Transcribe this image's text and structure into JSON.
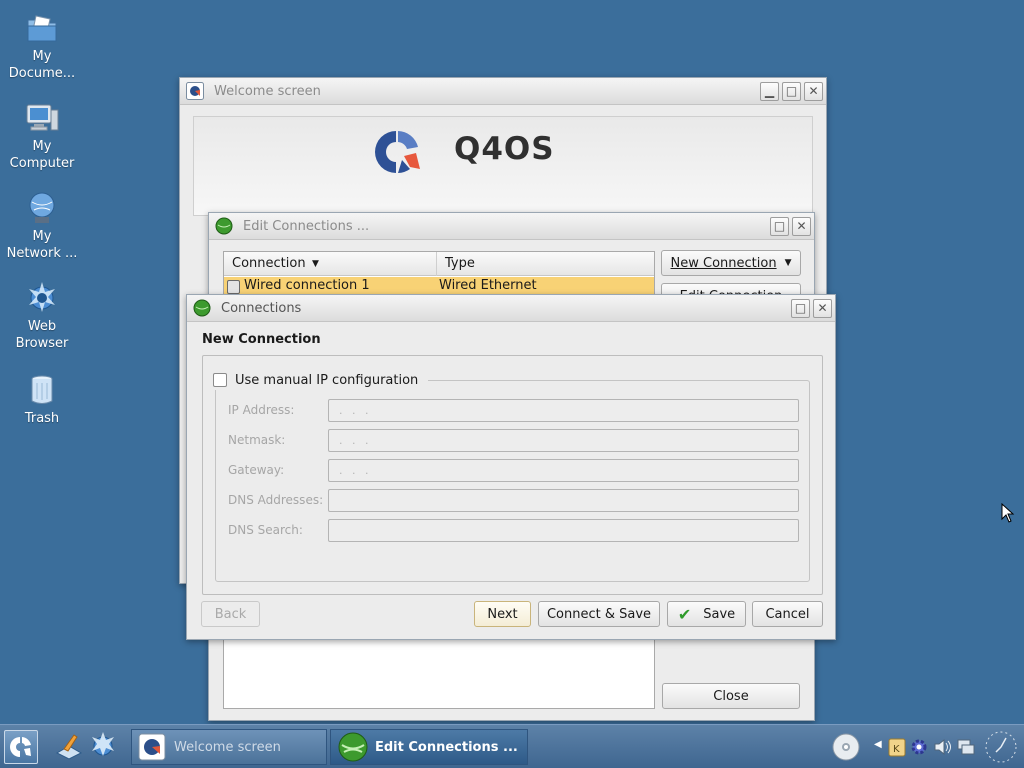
{
  "desktop": {
    "icons": [
      {
        "label": "My\nDocume...",
        "icon": "folder-documents-icon"
      },
      {
        "label": "My\nComputer",
        "icon": "computer-icon"
      },
      {
        "label": "My\nNetwork ...",
        "icon": "network-icon"
      },
      {
        "label": "Web\nBrowser",
        "icon": "web-browser-icon"
      },
      {
        "label": "Trash",
        "icon": "trash-icon"
      }
    ]
  },
  "welcome_window": {
    "title": "Welcome screen",
    "brand_text": "Q4OS"
  },
  "edit_connections_window": {
    "title": "Edit Connections ...",
    "columns": [
      "Connection",
      "Type"
    ],
    "rows": [
      {
        "connection": "Wired connection 1",
        "type": "Wired Ethernet",
        "selected": true
      }
    ],
    "new_connection_button": "New Connection",
    "edit_connection_button": "Edit Connection",
    "close_button": "Close"
  },
  "connections_dialog": {
    "title": "Connections",
    "heading": "New Connection",
    "manual_ip_checkbox": {
      "label": "Use manual IP configuration",
      "checked": false
    },
    "fields": [
      {
        "label": "IP Address:",
        "value": ". . ."
      },
      {
        "label": "Netmask:",
        "value": ". . ."
      },
      {
        "label": "Gateway:",
        "value": ". . ."
      },
      {
        "label": "DNS Addresses:",
        "value": ""
      },
      {
        "label": "DNS Search:",
        "value": ""
      }
    ],
    "buttons": {
      "back": "Back",
      "next": "Next",
      "connect_save": "Connect & Save",
      "save": "Save",
      "cancel": "Cancel"
    }
  },
  "taskbar": {
    "tasks": [
      {
        "label": "Welcome screen",
        "active": false
      },
      {
        "label": "Edit Connections ...",
        "active": true
      }
    ]
  },
  "colors": {
    "desktop": "#3b6e9b",
    "selection": "#f8d275",
    "taskbar": "#4f77a0"
  }
}
